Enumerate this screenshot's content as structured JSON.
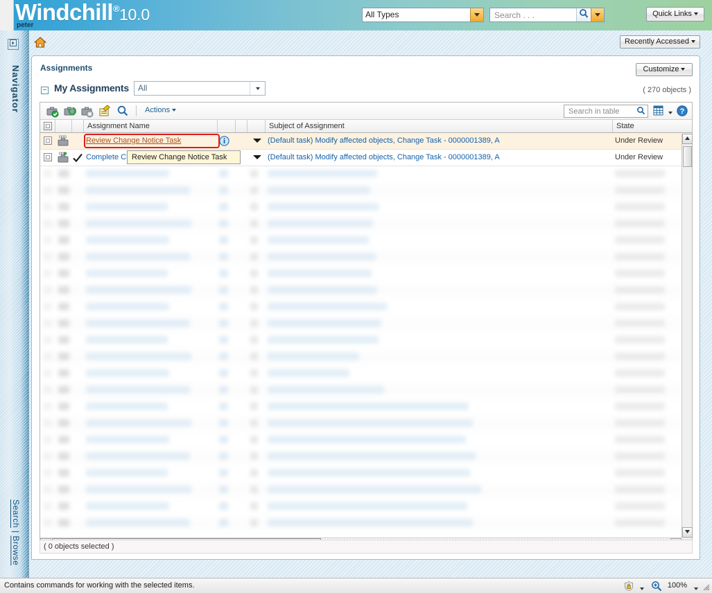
{
  "banner": {
    "logo_text": "Windchill",
    "logo_reg": "®",
    "logo_version": "10.0",
    "username": "peter",
    "type_filter_value": "All Types",
    "search_placeholder": "Search . . .",
    "search_value": "",
    "quick_links_label": "Quick Links",
    "icons": {
      "search_magnifier": "search-icon",
      "type_dropdown": "chevron-down-icon",
      "search_dropdown": "chevron-down-icon",
      "quick_links_caret": "chevron-down-icon"
    }
  },
  "navigator": {
    "label": "Navigator",
    "expand_icon": "expand-right-icon",
    "bottom_links": [
      "Search",
      "Browse"
    ],
    "bottom_separator": " | "
  },
  "content_header": {
    "home_icon": "home-icon",
    "recently_accessed_label": "Recently Accessed"
  },
  "panel": {
    "title": "Assignments",
    "customize_label": "Customize",
    "collapse_toggle": "−",
    "section_title": "My Assignments",
    "filter_value": "All",
    "object_count": "( 270 objects )",
    "footer_status": "( 0 objects selected )"
  },
  "toolbar": {
    "icons": [
      {
        "name": "checkout-icon",
        "title": "Check Out"
      },
      {
        "name": "checkin-icon",
        "title": "Check In"
      },
      {
        "name": "undo-checkout-icon",
        "title": "Undo Check Out"
      },
      {
        "name": "edit-icon",
        "title": "Edit"
      },
      {
        "name": "search-icon",
        "title": "Search"
      }
    ],
    "actions_label": "Actions",
    "search_in_table_placeholder": "Search in table",
    "search_in_table_value": "",
    "grid_icon": "table-view-icon",
    "grid_caret": "chevron-down-icon",
    "help_icon": "help-icon"
  },
  "table": {
    "columns": [
      {
        "key": "checkbox",
        "label": ""
      },
      {
        "key": "icon",
        "label": ""
      },
      {
        "key": "status",
        "label": ""
      },
      {
        "key": "assignment_name",
        "label": "Assignment Name"
      },
      {
        "key": "info",
        "label": ""
      },
      {
        "key": "spacer",
        "label": ""
      },
      {
        "key": "menu",
        "label": ""
      },
      {
        "key": "subject",
        "label": "Subject of Assignment"
      },
      {
        "key": "state",
        "label": "State"
      }
    ],
    "rows": [
      {
        "assignment_name": "Review Change Notice Task",
        "subject": "(Default task) Modify affected objects, Change Task - 0000001389, A",
        "state": "Under Review",
        "selected": true,
        "highlighted": true,
        "has_info_icon": true,
        "has_check_icon": false
      },
      {
        "assignment_name": "Complete Change Notice Task",
        "subject": "(Default task) Modify affected objects, Change Task - 0000001389, A",
        "state": "Under Review",
        "selected": false,
        "highlighted": false,
        "has_info_icon": false,
        "has_check_icon": true
      }
    ],
    "tooltip_text": "Review Change Notice Task",
    "scroll": {
      "v_up_icon": "scroll-up-icon",
      "v_down_icon": "scroll-down-icon",
      "h_left_icon": "scroll-left-icon",
      "h_right_icon": "scroll-right-icon"
    }
  },
  "statusbar": {
    "message": "Contains commands for working with the selected items.",
    "zone_icon": "security-zone-icon",
    "zoom_icon": "zoom-icon",
    "zoom_level": "100%",
    "resize_grip": "resize-grip-icon"
  },
  "colors": {
    "accent_blue": "#1560a8",
    "highlight_red": "#e01b1b",
    "task_link": "#a8521c",
    "selected_row": "#fdf2e0",
    "tooltip_bg": "#fdf6d8"
  }
}
